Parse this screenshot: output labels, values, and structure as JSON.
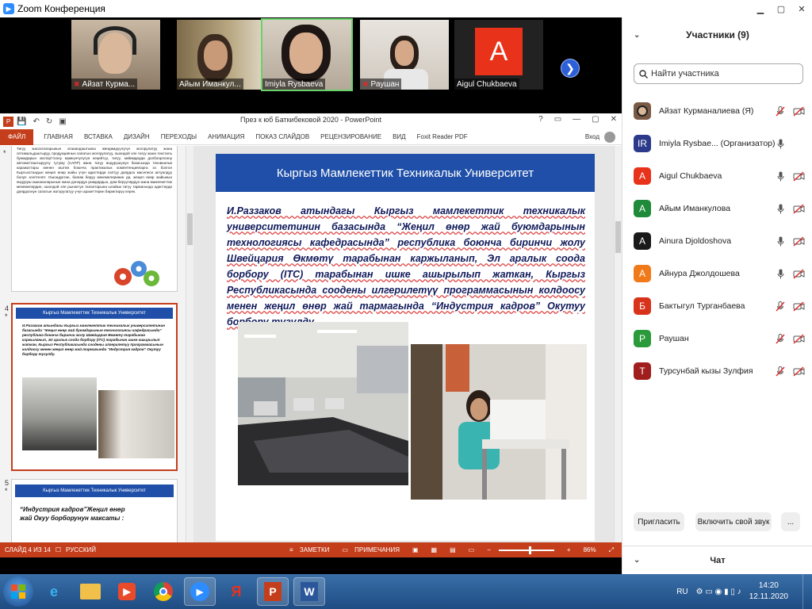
{
  "zoom": {
    "window_title": "Zoom Конференция",
    "participants": [
      {
        "name": "Айзат Курманалиева (Я)",
        "short": "Айзат Курма...",
        "initial": "",
        "color": "#7a5a44",
        "muted": true,
        "video_off": true
      },
      {
        "name": "Imiyla Rysbae... (Организатор)",
        "short": "Imiyla Rysbaeva",
        "initial": "IR",
        "color": "#2b3a8a",
        "muted": false,
        "video_off": false
      },
      {
        "name": "Aigul Chukbaeva",
        "short": "Aigul Chukbaeva",
        "initial": "A",
        "color": "#e8321a",
        "muted": false,
        "video_off": true
      },
      {
        "name": "Айым Иманкулова",
        "short": "Айым Иманкул...",
        "initial": "A",
        "color": "#1e8a3a",
        "muted": false,
        "video_off": true
      },
      {
        "name": "Ainura Djoldoshova",
        "short": "",
        "initial": "A",
        "color": "#1a1a1a",
        "muted": false,
        "video_off": true
      },
      {
        "name": "Айнура Джолдошева",
        "short": "",
        "initial": "A",
        "color": "#f07a1a",
        "muted": false,
        "video_off": true
      },
      {
        "name": "Бактыгул Турганбаева",
        "short": "",
        "initial": "Б",
        "color": "#d8321a",
        "muted": true,
        "video_off": true
      },
      {
        "name": "Раушан",
        "short": "Раушан",
        "initial": "P",
        "color": "#2a9a3a",
        "muted": true,
        "video_off": true
      },
      {
        "name": "Турсунбай кызы Зулфия",
        "short": "",
        "initial": "T",
        "color": "#a01e1e",
        "muted": true,
        "video_off": true
      }
    ],
    "panel": {
      "title": "Участники (9)",
      "search_placeholder": "Найти участника",
      "invite": "Пригласить",
      "unmute": "Включить свой звук",
      "more": "...",
      "chat": "Чат"
    }
  },
  "ppt": {
    "title": "През к юб Баткибековой 2020 - PowerPoint",
    "tabs": [
      "ФАЙЛ",
      "ГЛАВНАЯ",
      "ВСТАВКА",
      "ДИЗАЙН",
      "ПЕРЕХОДЫ",
      "АНИМАЦИЯ",
      "ПОКАЗ СЛАЙДОВ",
      "РЕЦЕНЗИРОВАНИЕ",
      "ВИД",
      "Foxit Reader PDF"
    ],
    "signin": "Вход",
    "thumb3_text": "Тигуу жасалгаларынын атааандаштыкка жөндөмдүүлүгүн жогорулатуу жана оптимальдаштыруу, продукциянын сапатын жогорулатуу, ошондой эле тигүү жана текстиль буюмдарын экспорттоону мүмкүнчүлүгүн кеңейтүү, тигүү, кийимдерди долбоорлоону автоматташтыруучу тутуму (САПР) жана тигуу өндүрүшүнүн базасында техникалык каражаттары менен иштөө боюнча практикалык компетенцияларга ээ болгон Кыргызстандын жеңил өнөр жайы үчүн адистерди саптуу даярдоо маселеси актуалдуу болуп эсептелет. Ошондуктан, билим беруу мекемелеринин да, жеңил өнөр жайынын өндүрүш ишканаларынын жана донордук уюмдардын, дем-берүүлөрдүн жана мамлекеттик мекемелердин, ошондой эле рыноктун талаптарына ылайык тигүү тармагында адистерди даярдоонун сапатын жогорулатуу үчүн аракеттерин бириктирүү керек.",
    "slide_header": "Кыргыз Мамлекеттик Техникалык Университет",
    "slide_body": "И.Раззаков атындагы Кыргыз мамлекеттик техникалык университетинин базасында “Жеңил өнөр жай буюмдарынын технологиясы кафедрасында” республика боюнча биринчи жолу Швейцария Өкмөтү тарабынан каржыланып, Эл аралык соода борбору (ITC) тарабынан ишке ашырылып жаткан, Кыргыз Республикасында соодены илгерилетүү программасынын колдоосу менен жеңил өнөр жай тармагында “Индустрия кадров” Окутуу борбору түзүлдү.",
    "thumb5_text": "“Индустрия кадров”Жеңил өнөр жай Окуу борборунун максаты :",
    "status_slide": "СЛАЙД 4 ИЗ 14",
    "status_lang": "РУССКИЙ",
    "notes": "ЗАМЕТКИ",
    "comments": "ПРИМЕЧАНИЯ",
    "zoom_level": "86%",
    "zoom_fraction": 0.55,
    "thumb_numbers": [
      "4",
      "5"
    ]
  },
  "taskbar": {
    "lang": "RU",
    "time": "14:20",
    "date": "12.11.2020",
    "apps": [
      "windows-explorer",
      "internet-explorer",
      "file-explorer",
      "media-player",
      "chrome",
      "zoom",
      "yandex",
      "powerpoint",
      "word"
    ]
  }
}
